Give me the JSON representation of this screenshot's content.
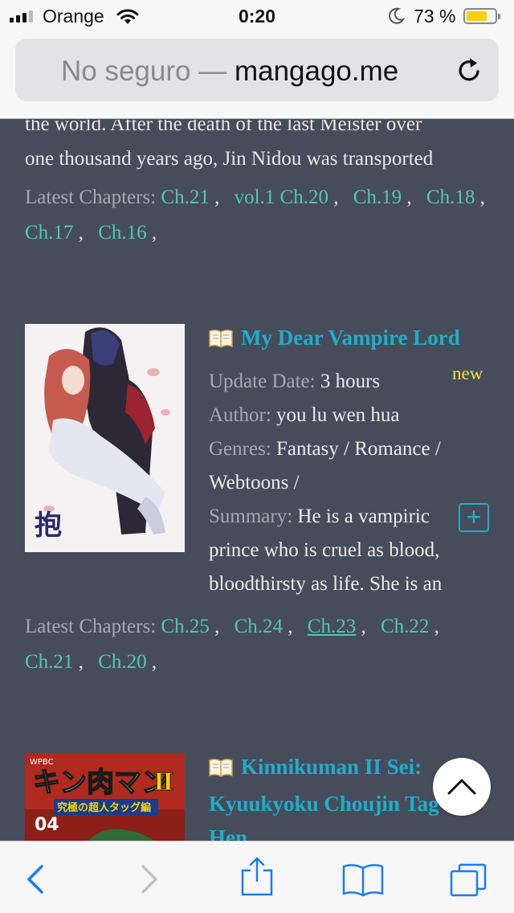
{
  "status": {
    "carrier": "Orange",
    "time": "0:20",
    "battery": "73 %",
    "battery_level": 0.73
  },
  "browser": {
    "insecure_label": "No seguro —",
    "domain": "mangago.me"
  },
  "prev_entry": {
    "desc_line_1": "the world. After the death of the last Meister over",
    "desc_line_2": "one thousand years ago, Jin Nidou was transported",
    "latest_label": "Latest Chapters:",
    "chapters": [
      "Ch.21",
      "vol.1 Ch.20",
      "Ch.19",
      "Ch.18",
      "Ch.17",
      "Ch.16"
    ]
  },
  "entry": {
    "title": "My Dear Vampire Lord",
    "badge": "new",
    "update_label": "Update Date:",
    "update_value": "3 hours",
    "author_label": "Author:",
    "author_value": "you lu wen hua",
    "genres_label": "Genres:",
    "genres_line_1": "Fantasy / Romance /",
    "genres_line_2": "Webtoons /",
    "summary_label": "Summary:",
    "summary_line_1": "He is a vampiric",
    "summary_line_2": "prince who is cruel as blood,",
    "summary_line_3": "bloodthirsty as life. She is an",
    "expand_symbol": "+",
    "latest_label": "Latest Chapters:",
    "chapters": [
      "Ch.25",
      "Ch.24",
      "Ch.23",
      "Ch.22",
      "Ch.21",
      "Ch.20"
    ],
    "cover_text": "抱"
  },
  "next_entry": {
    "title_line_1": "Kinnikuman II Sei:",
    "title_line_2": "Kyuukyoku Choujin Tag",
    "title_line_3": "Hen",
    "cover_brand": "WPBC",
    "cover_title": "キン肉マン",
    "cover_subtitle": "究極の超人タッグ編",
    "cover_volume": "04"
  },
  "colors": {
    "page_bg": "#474c5b",
    "link_teal": "#4fc8b2",
    "title_blue": "#1eaecb",
    "badge_yellow": "#f2e43a",
    "label_gray": "#a7a9b1",
    "ios_blue": "#1a7cf5"
  },
  "icons": {
    "back": "chevron-left-icon",
    "forward": "chevron-right-icon",
    "share": "share-icon",
    "bookmarks": "book-icon",
    "tabs": "tabs-icon",
    "reload": "reload-icon",
    "scroll_top": "chevron-up-icon"
  }
}
